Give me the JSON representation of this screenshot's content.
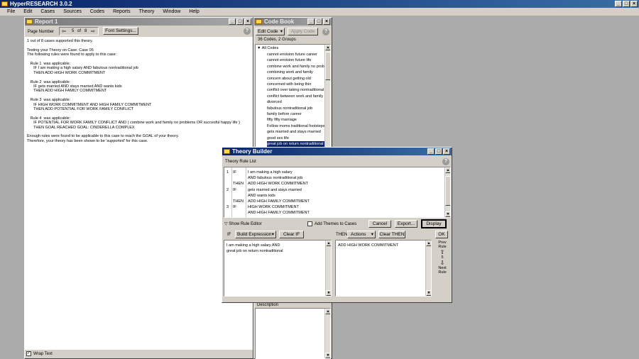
{
  "app": {
    "title": "HyperRESEARCH 3.0.2",
    "menu": [
      "File",
      "Edit",
      "Cases",
      "Sources",
      "Codes",
      "Reports",
      "Theory",
      "Window",
      "Help"
    ]
  },
  "report": {
    "title": "Report 1",
    "page_number_label": "Page Number",
    "page_current": "5",
    "page_of": "of",
    "page_total": "8",
    "font_settings_label": "Font Settings...",
    "lines": [
      "1 out of 8 cases supported this theory.",
      "",
      "Testing your Theory on Case: Case 05",
      "The following rules were found to apply to this case:",
      "",
      "   Rule 1  was applicable:",
      "      IF I am making a high salary AND fabulous nontraditional job",
      "      THEN ADD HIGH WORK COMMITMENT",
      "",
      "   Rule 2  was applicable:",
      "      IF gets married AND stays married AND wants kids",
      "      THEN ADD HIGH FAMILY COMMITMENT",
      "",
      "   Rule 3  was applicable:",
      "      IF HIGH WORK COMMITMENT AND HIGH FAMILY COMMITMENT",
      "      THEN ADD POTENTIAL FOR WORK FAMILY CONFLICT",
      "",
      "   Rule 4  was applicable:",
      "      IF POTENTIAL FOR WORK FAMILY CONFLICT AND ( combine work and family no problems OR succesful happy life )",
      "      THEN GOAL REACHED GOAL: CINDERELLA COMPLEX",
      "",
      "Enough rules were found to be applicable to this case to reach the GOAL of your theory.",
      "Therefore, your theory has been shown to be 'supported' for this case."
    ],
    "wrap_text_label": "Wrap Text"
  },
  "codebook": {
    "title": "Code Book",
    "edit_code_label": "Edit Code",
    "apply_code_label": "Apply Code",
    "summary": "36 Codes, 2 Groups",
    "all_codes_label": "All Codes",
    "codes": [
      "cannot envision future career",
      "cannot envision future life",
      "combine work and family no problem",
      "combining work and family",
      "concern about getting old",
      "concerned with being thin",
      "conflict over taking nontraditional ro",
      "conflict between work and family",
      "divorced",
      "fabulous nontraditional job",
      "family before career",
      "fifty fifty marriage",
      "Follow moms traditional footsteps",
      "gets married and stays married",
      "good sex life",
      "great job on return nontraditional"
    ],
    "selected_index": 15,
    "description_label": "Description"
  },
  "theory_builder": {
    "title": "Theory Builder",
    "rule_list_label": "Theory Rule List",
    "rules": [
      {
        "num": "1",
        "kw": "IF",
        "text": "I am making a high salary"
      },
      {
        "num": "",
        "kw": "",
        "text": "AND fabulous nontraditional job"
      },
      {
        "num": "",
        "kw": "THEN",
        "text": "ADD HIGH WORK COMMITMENT"
      },
      {
        "num": "2",
        "kw": "IF",
        "text": "gets married and stays married"
      },
      {
        "num": "",
        "kw": "",
        "text": "AND wants kids"
      },
      {
        "num": "",
        "kw": "THEN",
        "text": "ADD HIGH FAMILY COMMITMENT"
      },
      {
        "num": "3",
        "kw": "IF",
        "text": "HIGH WORK COMMITMENT"
      },
      {
        "num": "",
        "kw": "",
        "text": "AND HIGH FAMILY COMMITMENT"
      }
    ],
    "show_rule_editor_label": "Show Rule Editor",
    "add_themes_label": "Add Themes to Cases",
    "cancel_label": "Cancel",
    "export_label": "Export...",
    "display_label": "Display",
    "if_label": "IF",
    "build_expression_label": "Build Expression",
    "clear_if_label": "Clear IF",
    "then_label": "THEN",
    "actions_label": "Actions",
    "clear_then_label": "Clear THEN",
    "ok_label": "OK",
    "if_text": [
      "I am making a high salary AND",
      "great job on return nontraditional"
    ],
    "then_text": "ADD HIGH WORK COMMITMENT",
    "prev_label": "Prev",
    "rule_label": "Rule",
    "current_rule": "5",
    "next_label": "Next",
    "next_rule_label": "Rule"
  }
}
